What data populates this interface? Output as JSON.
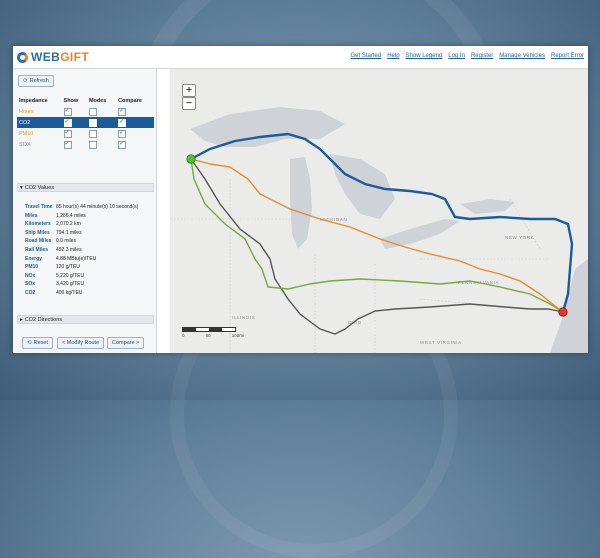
{
  "app": {
    "logo_prefix": "WEB",
    "logo_suffix": "GIFT"
  },
  "topnav": [
    "Get Started",
    "Help",
    "Show Legend",
    "Log In",
    "Register",
    "Manage Vehicles",
    "Report Error"
  ],
  "sidebar": {
    "refresh_label": "Refresh",
    "impedance_headers": [
      "Impedance",
      "Show",
      "Modes",
      "Compare"
    ],
    "impedance_rows": [
      {
        "label": "Hours",
        "color": "#d4a017",
        "show": true,
        "modes": false,
        "compare": true,
        "selected": false
      },
      {
        "label": "CO2",
        "color": "#ffffff",
        "show": true,
        "modes": false,
        "compare": true,
        "selected": true
      },
      {
        "label": "PM10",
        "color": "#d4a017",
        "show": true,
        "modes": false,
        "compare": true,
        "selected": false
      },
      {
        "label": "SOX",
        "color": "#888888",
        "show": true,
        "modes": false,
        "compare": true,
        "selected": false
      }
    ],
    "values_header": "CO2 Values",
    "values": [
      {
        "key": "Travel Time",
        "value": "85 hour(s) 44 minute(s) 10 second(s)"
      },
      {
        "key": "Miles",
        "value": "1,286.4 miles"
      },
      {
        "key": "Kilometers",
        "value": "2,070.2 km"
      },
      {
        "key": "Ship Miles",
        "value": "794.1 miles"
      },
      {
        "key": "Road Miles",
        "value": "0.0 miles"
      },
      {
        "key": "Rail Miles",
        "value": "492.3 miles"
      },
      {
        "key": "Energy",
        "value": "4.88 MBtu(e)/TEU"
      },
      {
        "key": "PM10",
        "value": "120 g/TEU"
      },
      {
        "key": "NOx",
        "value": "5,220 g/TEU"
      },
      {
        "key": "SOx",
        "value": "3,420 g/TEU"
      },
      {
        "key": "CO2",
        "value": "400 kg/TEU"
      }
    ],
    "directions_header": "CO2 Directions",
    "reset_label": "Reset",
    "modify_label": "< Modify Route",
    "compare_label": "Compare >"
  },
  "map": {
    "zoom_in": "+",
    "zoom_out": "−",
    "scale_labels": [
      "0",
      "50",
      "100mi"
    ],
    "place_labels": [
      "MICHIGAN",
      "ILLINOIS",
      "OHIO",
      "PENNSYLVANIA",
      "WEST VIRGINIA",
      "NEW YORK"
    ],
    "route_colors": {
      "co2": "#1d5c9b",
      "hours": "#e8892a",
      "pm10": "#7aa83a",
      "sox": "#555555"
    },
    "origin_color": "#4cc23a",
    "destination_color": "#e23a2a"
  }
}
